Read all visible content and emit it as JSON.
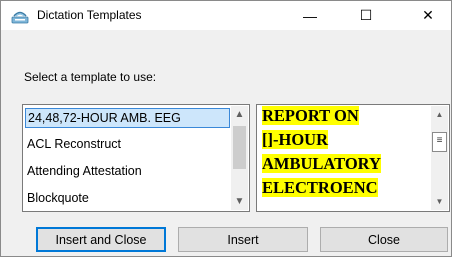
{
  "window": {
    "title": "Dictation Templates",
    "minimize_glyph": "—",
    "maximize_glyph": "☐",
    "close_glyph": "✕"
  },
  "prompt": "Select a template to use:",
  "templates": {
    "items": [
      "24,48,72-HOUR AMB. EEG",
      "ACL Reconstruct",
      "Attending Attestation",
      "Blockquote"
    ],
    "selected": "24,48,72-HOUR AMB. EEG"
  },
  "preview": {
    "lines": [
      "REPORT ON",
      "[]-HOUR",
      "AMBULATORY",
      "ELECTROENC"
    ],
    "highlight_color": "#ffff00"
  },
  "buttons": {
    "insert_and_close": "Insert and Close",
    "insert": "Insert",
    "close": "Close"
  },
  "colors": {
    "selection_bg": "#cde6fb",
    "selection_border": "#3a88d8",
    "default_button_border": "#0078d7"
  }
}
